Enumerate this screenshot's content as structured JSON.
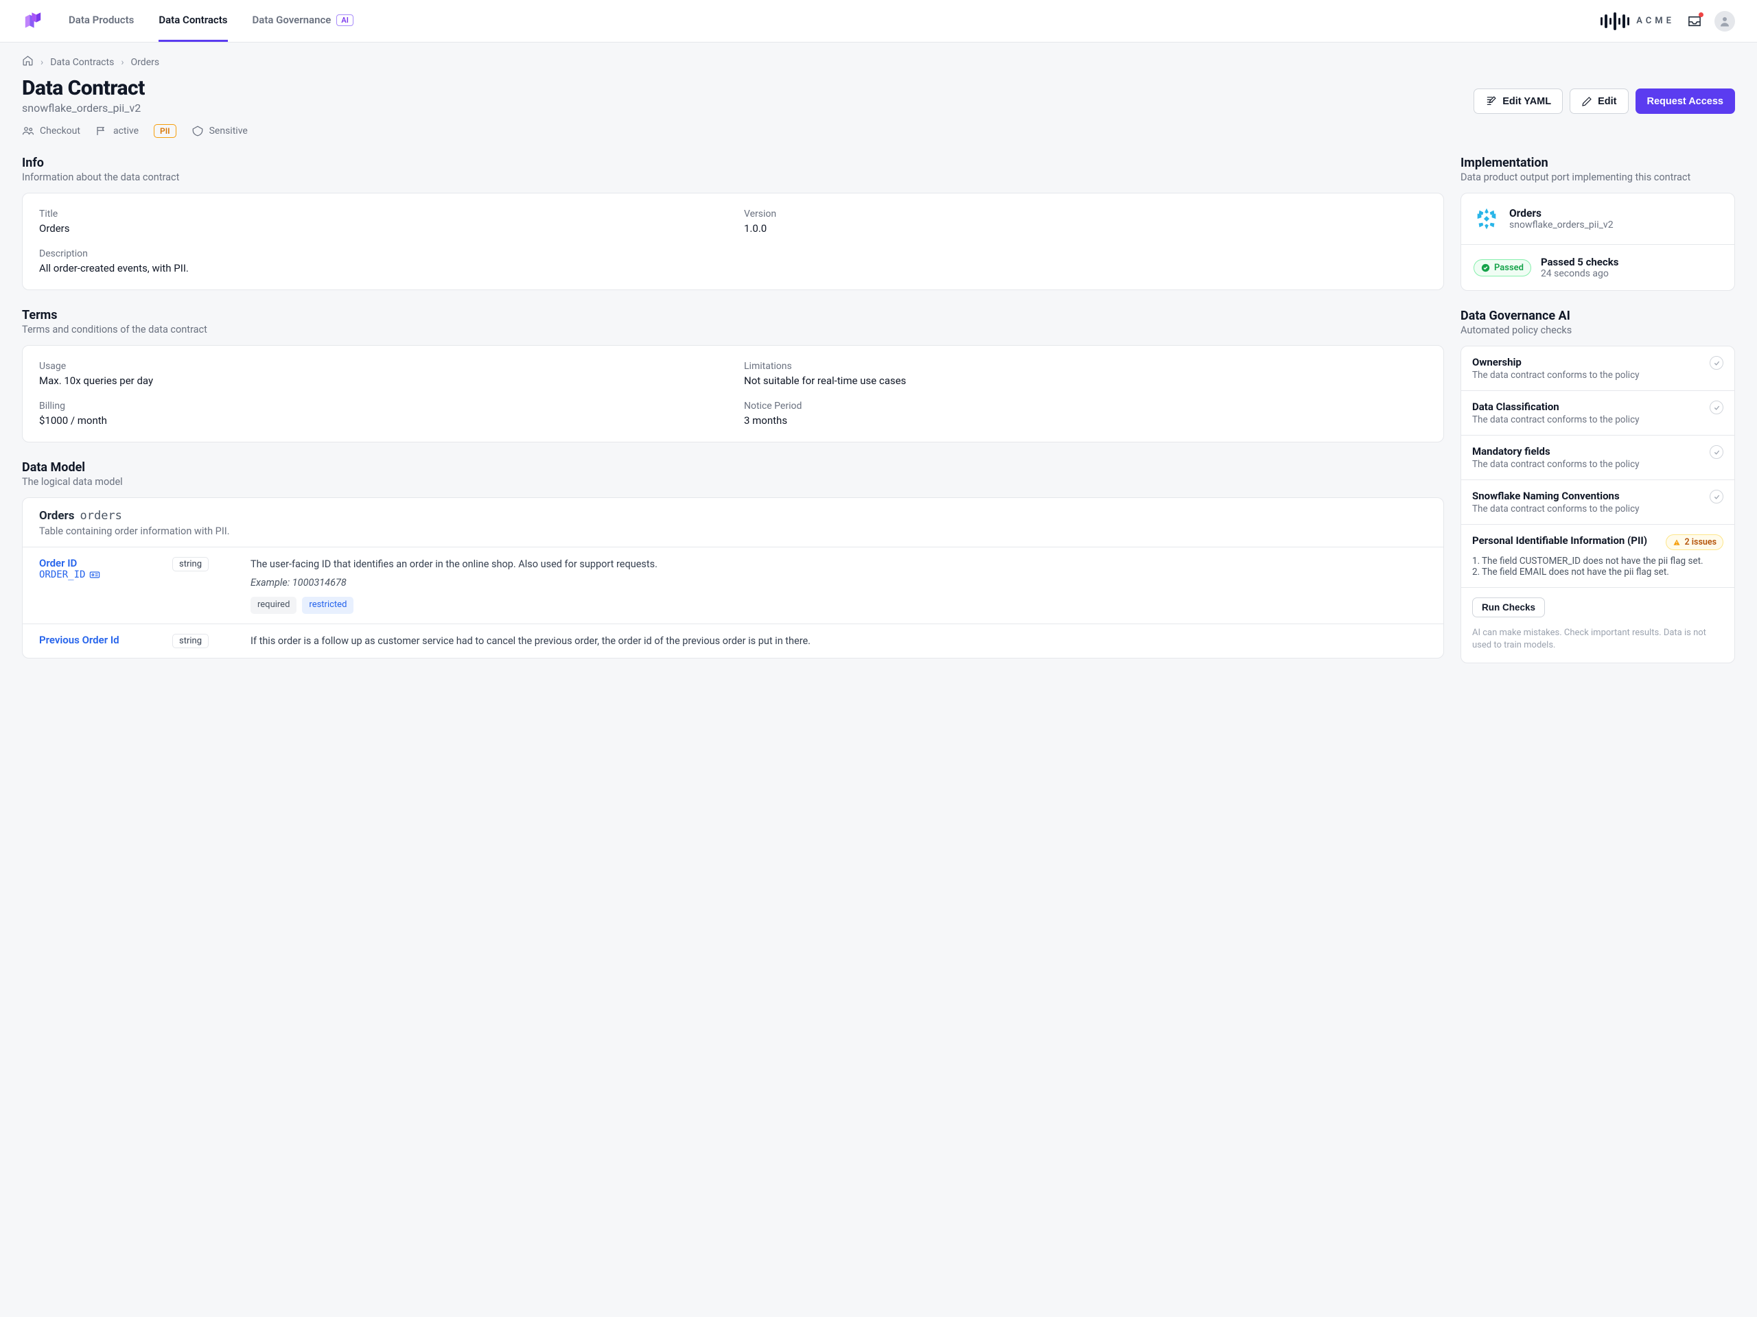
{
  "nav": {
    "tabs": [
      {
        "label": "Data Products"
      },
      {
        "label": "Data Contracts"
      },
      {
        "label": "Data Governance",
        "badge": "AI"
      }
    ],
    "brand": "ACME"
  },
  "breadcrumb": {
    "item1": "Data Contracts",
    "item2": "Orders"
  },
  "header": {
    "title": "Data Contract",
    "subtitle": "snowflake_orders_pii_v2",
    "actions": {
      "editYaml": "Edit YAML",
      "edit": "Edit",
      "request": "Request Access"
    }
  },
  "meta": {
    "team": "Checkout",
    "status": "active",
    "pii": "PII",
    "sensitivity": "Sensitive"
  },
  "info": {
    "title": "Info",
    "sub": "Information about the data contract",
    "fields": {
      "titleLabel": "Title",
      "titleValue": "Orders",
      "versionLabel": "Version",
      "versionValue": "1.0.0",
      "descLabel": "Description",
      "descValue": "All order-created events, with PII."
    }
  },
  "terms": {
    "title": "Terms",
    "sub": "Terms and conditions of the data contract",
    "fields": {
      "usageLabel": "Usage",
      "usageValue": "Max. 10x queries per day",
      "limitLabel": "Limitations",
      "limitValue": "Not suitable for real-time use cases",
      "billingLabel": "Billing",
      "billingValue": "$1000 / month",
      "noticeLabel": "Notice Period",
      "noticeValue": "3 months"
    }
  },
  "model": {
    "title": "Data Model",
    "sub": "The logical data model",
    "tableName": "Orders",
    "tableTech": "orders",
    "tableDesc": "Table containing order information with PII.",
    "fields": [
      {
        "friendly": "Order ID",
        "tech": "ORDER_ID",
        "type": "string",
        "desc": "The user-facing ID that identifies an order in the online shop. Also used for support requests.",
        "example": "Example: 1000314678",
        "tags": [
          "required",
          "restricted"
        ]
      },
      {
        "friendly": "Previous Order Id",
        "tech": "",
        "type": "string",
        "desc": "If this order is a follow up as customer service had to cancel the previous order, the order id of the previous order is put in there.",
        "example": "",
        "tags": []
      }
    ]
  },
  "impl": {
    "title": "Implementation",
    "sub": "Data product output port implementing this contract",
    "name": "Orders",
    "tech": "snowflake_orders_pii_v2",
    "passedLabel": "Passed",
    "statusMain": "Passed 5 checks",
    "statusSub": "24 seconds ago"
  },
  "gov": {
    "title": "Data Governance AI",
    "sub": "Automated policy checks",
    "items": [
      {
        "name": "Ownership",
        "desc": "The data contract conforms to the policy",
        "ok": true
      },
      {
        "name": "Data Classification",
        "desc": "The data contract conforms to the policy",
        "ok": true
      },
      {
        "name": "Mandatory fields",
        "desc": "The data contract conforms to the policy",
        "ok": true
      },
      {
        "name": "Snowflake Naming Conventions",
        "desc": "The data contract conforms to the policy",
        "ok": true
      }
    ],
    "piiItem": {
      "name": "Personal Identifiable Information (PII)",
      "badge": "2 issues",
      "issues": [
        "The field CUSTOMER_ID does not have the pii flag set.",
        "The field EMAIL does not have the pii flag set."
      ]
    },
    "runChecks": "Run Checks",
    "disclaimer": "AI can make mistakes. Check important results. Data is not used to train models."
  }
}
